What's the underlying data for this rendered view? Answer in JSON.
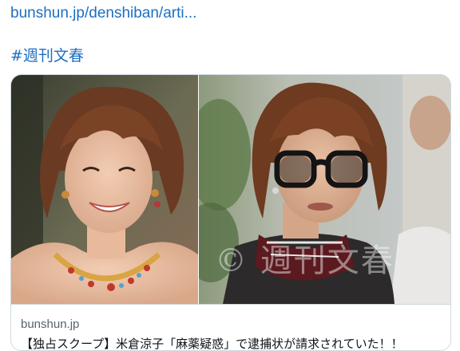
{
  "tweet": {
    "link_text": "bunshun.jp/denshiban/arti...",
    "hashtag": "#週刊文春"
  },
  "card": {
    "domain": "bunshun.jp",
    "title": "【独占スクープ】米倉涼子「麻薬疑惑」で逮捕状が請求されていた！！",
    "watermark": "© 週刊文春",
    "left_image_desc": "smiling-woman-with-necklace-photo",
    "right_image_desc": "woman-with-glasses-and-scarf-photo"
  },
  "colors": {
    "link": "#1d6fc2",
    "border": "#cfd9de",
    "domain_text": "#536471"
  }
}
